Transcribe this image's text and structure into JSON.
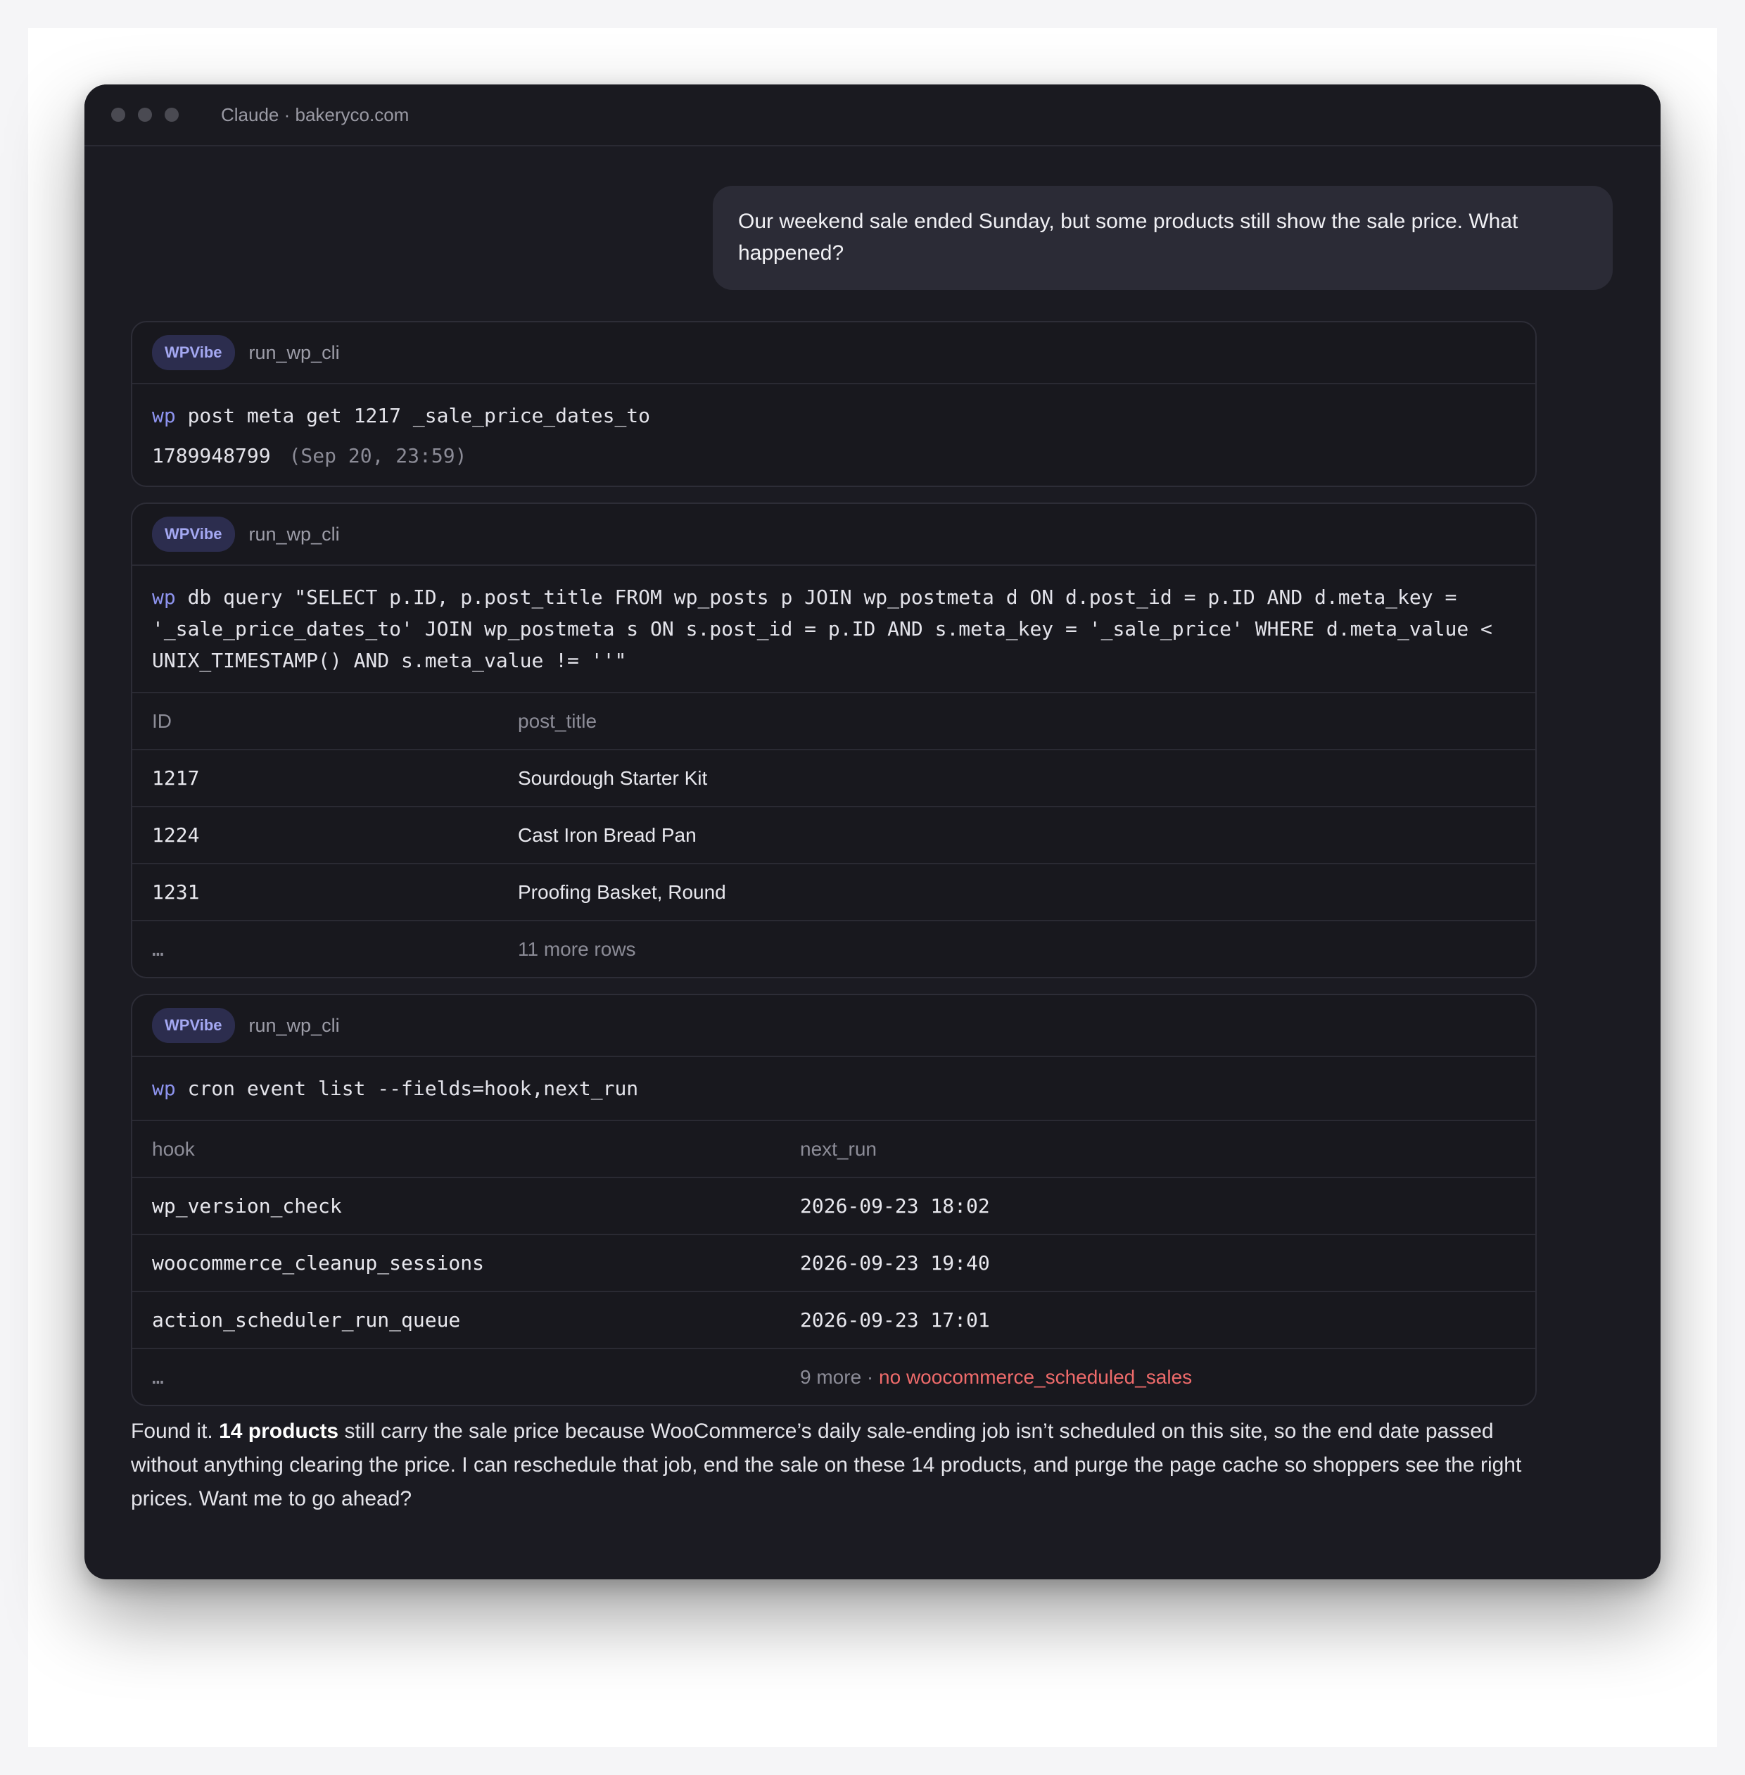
{
  "window": {
    "title": "Claude · bakeryco.com"
  },
  "user_message": "Our weekend sale ended Sunday, but some products still show the sale price. What happened?",
  "tool_calls": [
    {
      "badge": "WPVibe",
      "tool": "run_wp_cli",
      "command_prefix": "wp",
      "command": "post meta get 1217 _sale_price_dates_to",
      "result_value": "1789948799",
      "result_note": "(Sep 20, 23:59)"
    },
    {
      "badge": "WPVibe",
      "tool": "run_wp_cli",
      "command_prefix": "wp",
      "command": "db query \"SELECT p.ID, p.post_title FROM wp_posts p JOIN wp_postmeta d ON d.post_id = p.ID AND d.meta_key = '_sale_price_dates_to' JOIN wp_postmeta s ON s.post_id = p.ID AND s.meta_key = '_sale_price' WHERE d.meta_value < UNIX_TIMESTAMP() AND s.meta_value != ''\"",
      "columns": [
        "ID",
        "post_title"
      ],
      "rows": [
        {
          "id": "1217",
          "title": "Sourdough Starter Kit"
        },
        {
          "id": "1224",
          "title": "Cast Iron Bread Pan"
        },
        {
          "id": "1231",
          "title": "Proofing Basket, Round"
        }
      ],
      "more_marker": "…",
      "more_text": "11 more rows"
    },
    {
      "badge": "WPVibe",
      "tool": "run_wp_cli",
      "command_prefix": "wp",
      "command": "cron event list --fields=hook,next_run",
      "columns": [
        "hook",
        "next_run"
      ],
      "rows": [
        {
          "hook": "wp_version_check",
          "next_run": "2026-09-23 18:02"
        },
        {
          "hook": "woocommerce_cleanup_sessions",
          "next_run": "2026-09-23 19:40"
        },
        {
          "hook": "action_scheduler_run_queue",
          "next_run": "2026-09-23 17:01"
        }
      ],
      "more_marker": "…",
      "more_text": "9 more ·",
      "warning": "no woocommerce_scheduled_sales"
    }
  ],
  "assistant_message": {
    "lead": "Found it.",
    "bold": "14 products",
    "rest": "still carry the sale price because WooCommerce’s daily sale-ending job isn’t scheduled on this site, so the end date passed without anything clearing the price. I can reschedule that job, end the sale on these 14 products, and purge the page cache so shoppers see the right prices. Want me to go ahead?"
  },
  "colors": {
    "window_bg": "#1b1b22",
    "badge_bg": "#2c2d4e",
    "badge_text": "#a4a8f2",
    "command_prefix": "#8d93ee",
    "warning": "#ef6b6b"
  }
}
